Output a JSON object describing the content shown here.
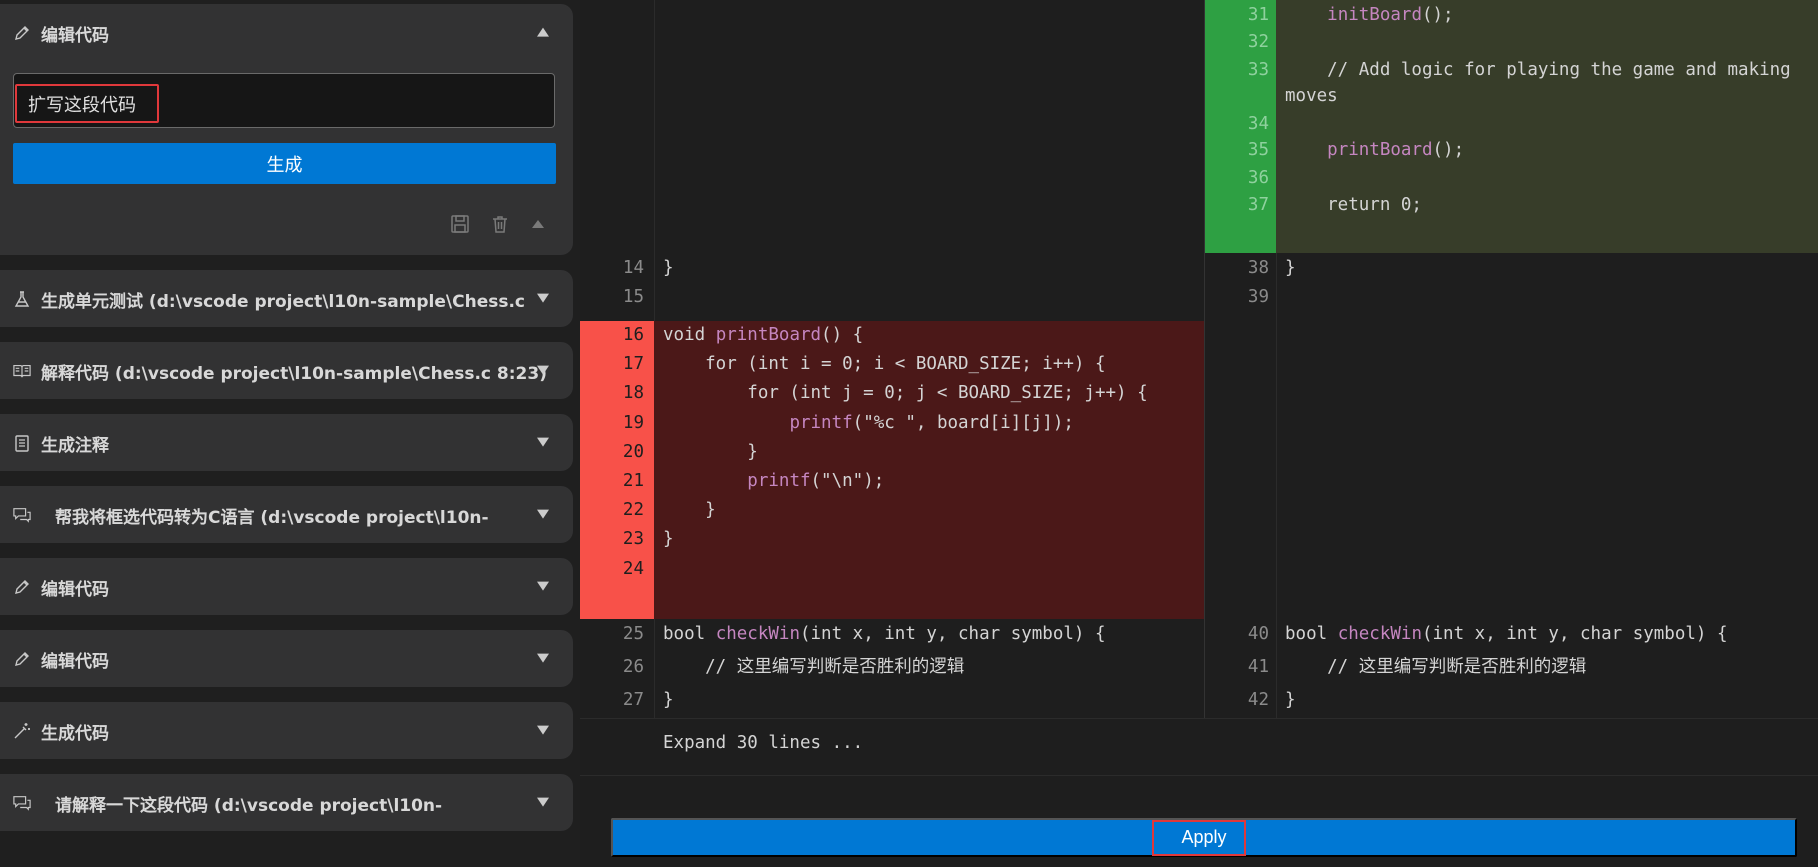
{
  "sidebar": {
    "active_card": {
      "title": "编辑代码",
      "prompt_value": "扩写这段代码",
      "generate_label": "生成"
    },
    "cards": [
      {
        "title": "生成单元测试 (d:\\vscode project\\l10n-sample\\Chess.c",
        "icon": "flask-icon"
      },
      {
        "title": "解释代码 (d:\\vscode project\\l10n-sample\\Chess.c 8:23)",
        "icon": "book-icon"
      },
      {
        "title": "生成注释",
        "icon": "notes-icon"
      },
      {
        "title": "帮我将框选代码转为C语言  (d:\\vscode project\\l10n-",
        "icon": "chat-icon"
      },
      {
        "title": "编辑代码",
        "icon": "pencil-icon"
      },
      {
        "title": "编辑代码",
        "icon": "pencil-icon"
      },
      {
        "title": "生成代码",
        "icon": "magic-wand-icon"
      },
      {
        "title": "请解释一下这段代码  (d:\\vscode project\\l10n-",
        "icon": "chat-icon"
      }
    ]
  },
  "diff": {
    "right_added": [
      {
        "ln": "31",
        "code": "    initBoard();"
      },
      {
        "ln": "32",
        "code": ""
      },
      {
        "ln": "33",
        "code": "    // Add logic for playing the game and making"
      },
      {
        "ln": "",
        "code": "moves"
      },
      {
        "ln": "34",
        "code": ""
      },
      {
        "ln": "35",
        "code": "    printBoard();"
      },
      {
        "ln": "36",
        "code": ""
      },
      {
        "ln": "37",
        "code": "    return 0;"
      }
    ],
    "left_context_top": [
      {
        "ln": "14",
        "code": "}"
      },
      {
        "ln": "15",
        "code": ""
      }
    ],
    "right_context_top": [
      {
        "ln": "38",
        "code": "}"
      },
      {
        "ln": "39",
        "code": ""
      }
    ],
    "left_removed": [
      {
        "ln": "16",
        "pre": "void ",
        "fn": "printBoard",
        "post": "() {"
      },
      {
        "ln": "17",
        "pre": "    for (int i = 0; i < BOARD_SIZE; i++) {",
        "fn": "",
        "post": ""
      },
      {
        "ln": "18",
        "pre": "        for (int j = 0; j < BOARD_SIZE; j++) {",
        "fn": "",
        "post": ""
      },
      {
        "ln": "19",
        "pre": "            ",
        "fn": "printf",
        "post": "(\"%c \", board[i][j]);"
      },
      {
        "ln": "20",
        "pre": "        }",
        "fn": "",
        "post": ""
      },
      {
        "ln": "21",
        "pre": "        ",
        "fn": "printf",
        "post": "(\"\\n\");"
      },
      {
        "ln": "22",
        "pre": "    }",
        "fn": "",
        "post": ""
      },
      {
        "ln": "23",
        "pre": "}",
        "fn": "",
        "post": ""
      },
      {
        "ln": "24",
        "pre": "",
        "fn": "",
        "post": ""
      }
    ],
    "left_bottom": [
      {
        "ln": "25",
        "pre": "bool ",
        "fn": "checkWin",
        "post": "(int x, int y, char symbol) {"
      },
      {
        "ln": "26",
        "pre": "    // 这里编写判断是否胜利的逻辑",
        "fn": "",
        "post": ""
      },
      {
        "ln": "27",
        "pre": "}",
        "fn": "",
        "post": ""
      }
    ],
    "right_bottom": [
      {
        "ln": "40",
        "pre": "bool ",
        "fn": "checkWin",
        "post": "(int x, int y, char symbol) {"
      },
      {
        "ln": "41",
        "pre": "    // 这里编写判断是否胜利的逻辑",
        "fn": "",
        "post": ""
      },
      {
        "ln": "42",
        "pre": "}",
        "fn": "",
        "post": ""
      }
    ],
    "expand_label": "Expand 30 lines ...",
    "apply_label": "Apply"
  },
  "colors": {
    "added_gutter": "#2ea043",
    "added_bg": "#373d29",
    "removed_gutter": "#f85149",
    "removed_bg": "#4b1818",
    "accent": "#0078d4"
  }
}
